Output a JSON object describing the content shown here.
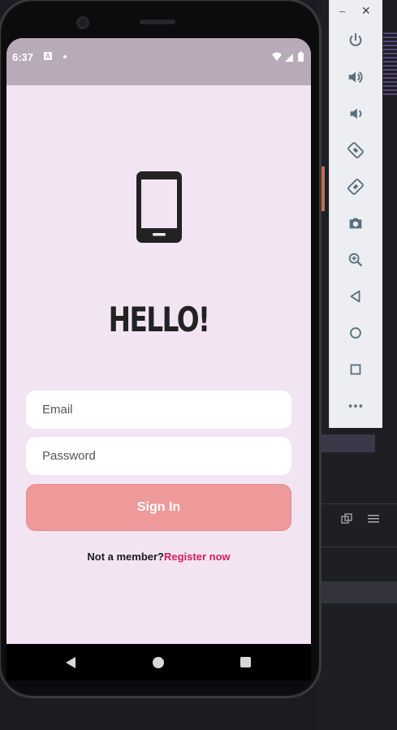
{
  "emulator_toolbar": {
    "minimize_label": "–",
    "close_label": "✕",
    "buttons": [
      "power-icon",
      "volume-up-icon",
      "volume-down-icon",
      "rotate-left-icon",
      "rotate-right-icon",
      "camera-icon",
      "zoom-in-icon",
      "back-icon",
      "home-icon",
      "overview-icon",
      "more-icon"
    ]
  },
  "status_bar": {
    "time": "6:37",
    "notification_letter": "A"
  },
  "screen": {
    "title": "HELLO!",
    "email_placeholder": "Email",
    "password_placeholder": "Password",
    "sign_in_label": "Sign In",
    "footer_prefix": "Not a member?",
    "register_link": "Register now"
  },
  "colors": {
    "screen_bg": "#f3e4f4",
    "status_bar": "#b8aab8",
    "sign_in_button": "#ee9a9a",
    "link": "#d81b60"
  }
}
